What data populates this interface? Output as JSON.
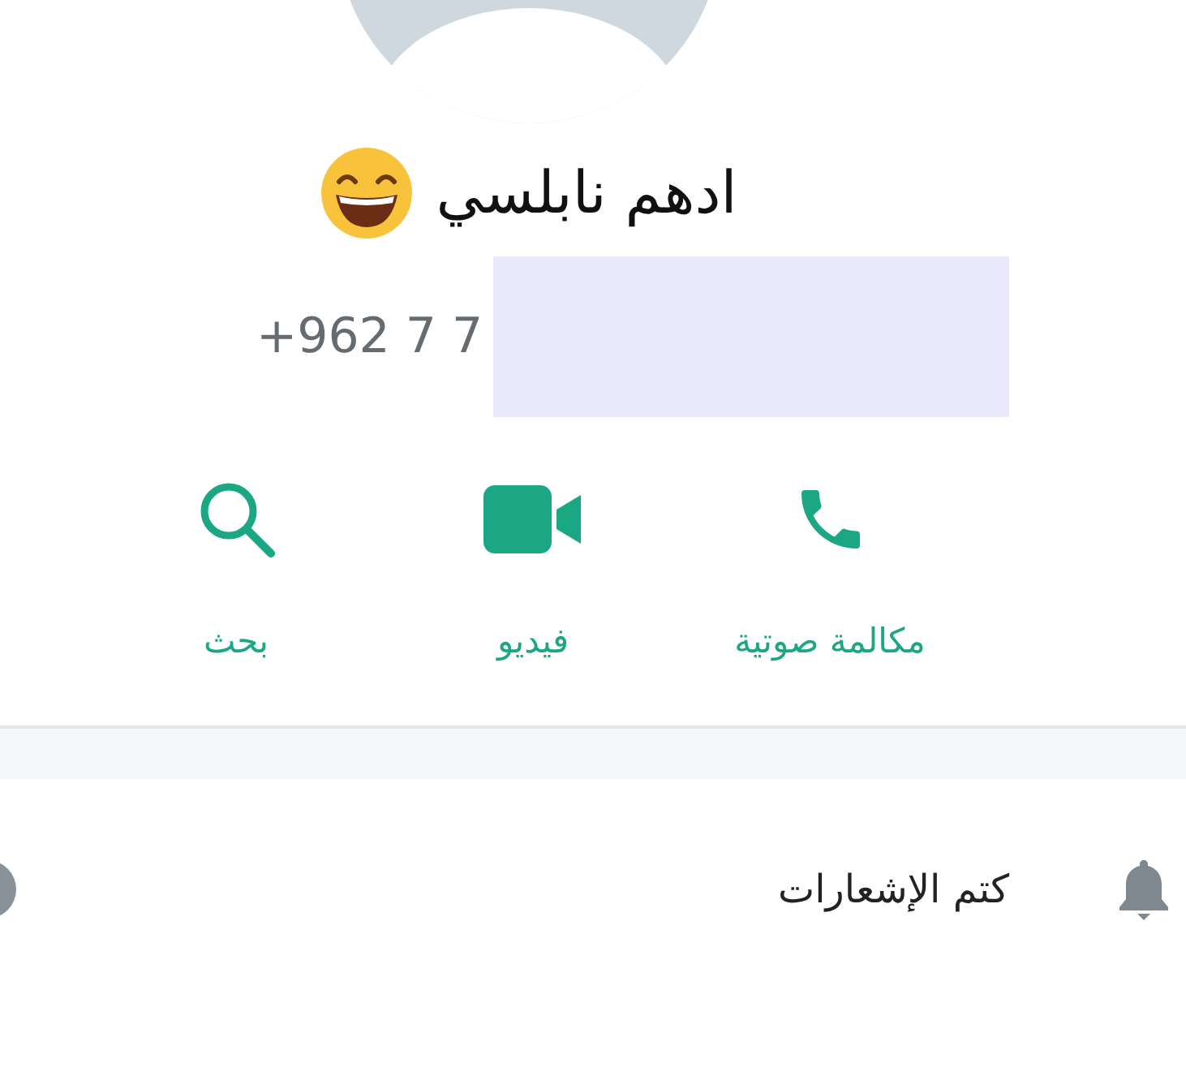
{
  "contact": {
    "name": "ادهم نابلسي",
    "phone": "+962 7 7"
  },
  "actions": [
    {
      "kind": "call",
      "label": "مكالمة صوتية"
    },
    {
      "kind": "video",
      "label": "فيديو"
    },
    {
      "kind": "search",
      "label": "بحث"
    }
  ],
  "settings": [
    {
      "kind": "mute",
      "label": "كتم الإشعارات",
      "on": false
    }
  ]
}
